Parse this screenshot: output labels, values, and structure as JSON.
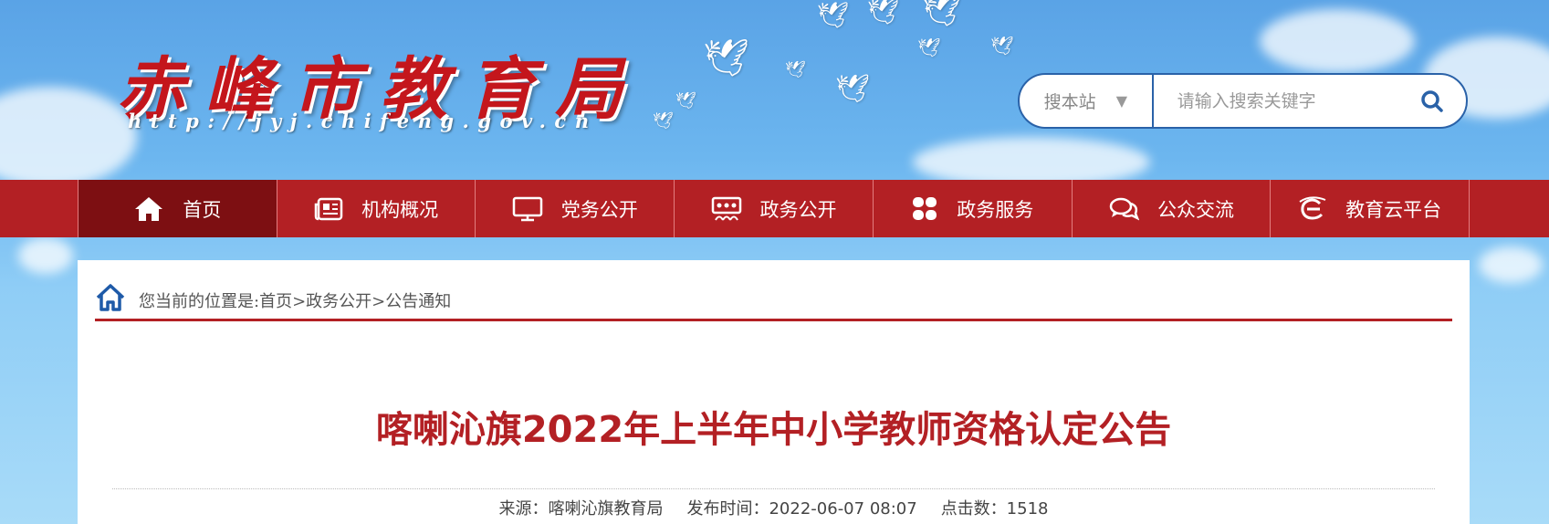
{
  "header": {
    "site_title": "赤峰市教育局",
    "site_url": "http://jyj.chifeng.gov.cn"
  },
  "search": {
    "scope": "搜本站",
    "placeholder": "请输入搜索关键字"
  },
  "nav": {
    "items": [
      {
        "label": "首页",
        "icon": "home-icon"
      },
      {
        "label": "机构概况",
        "icon": "newspaper-icon"
      },
      {
        "label": "党务公开",
        "icon": "monitor-icon"
      },
      {
        "label": "政务公开",
        "icon": "meeting-screen-icon"
      },
      {
        "label": "政务服务",
        "icon": "grid-icon"
      },
      {
        "label": "公众交流",
        "icon": "chat-bubbles-icon"
      },
      {
        "label": "教育云平台",
        "icon": "cloud-e-icon"
      }
    ]
  },
  "breadcrumb": {
    "text": "您当前的位置是:首页>政务公开>公告通知"
  },
  "article": {
    "title": "喀喇沁旗2022年上半年中小学教师资格认定公告",
    "source": "来源：喀喇沁旗教育局",
    "published": "发布时间：2022-06-07 08:07",
    "views": "点击数：1518"
  },
  "colors": {
    "nav_bg": "#b32024",
    "nav_active": "#7d0f12",
    "title_red": "#b32024",
    "search_border": "#2a62a8"
  }
}
